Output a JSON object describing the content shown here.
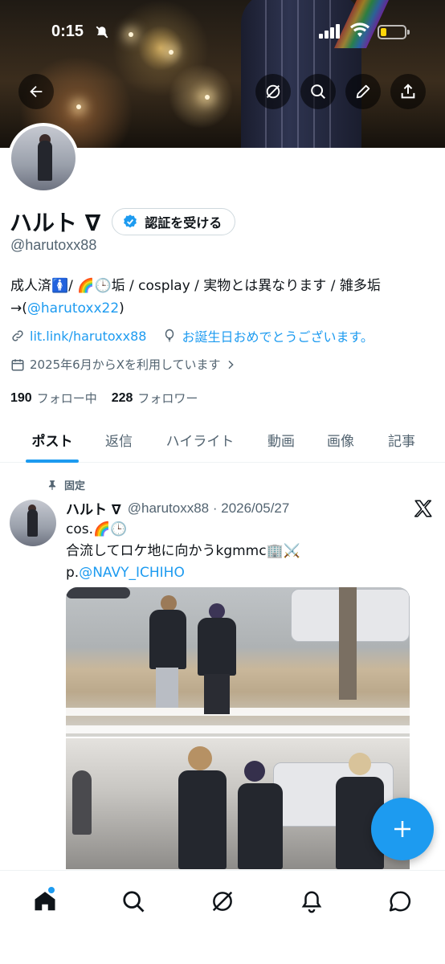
{
  "status_bar": {
    "time": "0:15"
  },
  "profile": {
    "display_name": "ハルト ∇",
    "verify_button": "認証を受ける",
    "handle": "@harutoxx88",
    "bio_line1": "成人済🚺/ 🌈🕒垢 / cosplay / 実物とは異なります / 雑多垢",
    "bio_line2_prefix": "→(",
    "bio_line2_link": "@harutoxx22",
    "bio_line2_suffix": ")",
    "website": "lit.link/harutoxx88",
    "birthday": "お誕生日おめでとうございます。",
    "joined": "2025年6月からXを利用しています",
    "following_count": "190",
    "following_label": "フォロー中",
    "followers_count": "228",
    "followers_label": "フォロワー"
  },
  "tabs": [
    {
      "label": "ポスト",
      "active": true
    },
    {
      "label": "返信"
    },
    {
      "label": "ハイライト"
    },
    {
      "label": "動画"
    },
    {
      "label": "画像"
    },
    {
      "label": "記事"
    }
  ],
  "post": {
    "pinned_label": "固定",
    "author_name": "ハルト ∇",
    "author_meta": "@harutoxx88 · 2026/05/27",
    "line1": "cos.🌈🕒",
    "line2": "合流してロケ地に向かうkgmmc🏢⚔️",
    "line3_prefix": "p.",
    "line3_link": "@NAVY_ICHIHO"
  },
  "colors": {
    "accent": "#1d9bf0",
    "text": "#0f1419",
    "secondary": "#536471"
  },
  "icons": {
    "back": "arrow-left-icon",
    "grok": "grok-icon",
    "search": "search-icon",
    "edit": "pencil-icon",
    "share": "share-icon",
    "verified": "verified-badge-icon",
    "link": "link-icon",
    "balloon": "balloon-icon",
    "calendar": "calendar-icon",
    "pin": "pin-icon",
    "x_logo": "x-logo-icon",
    "compose": "plus-icon",
    "home": "home-icon",
    "notifications": "bell-icon",
    "messages": "message-icon"
  }
}
